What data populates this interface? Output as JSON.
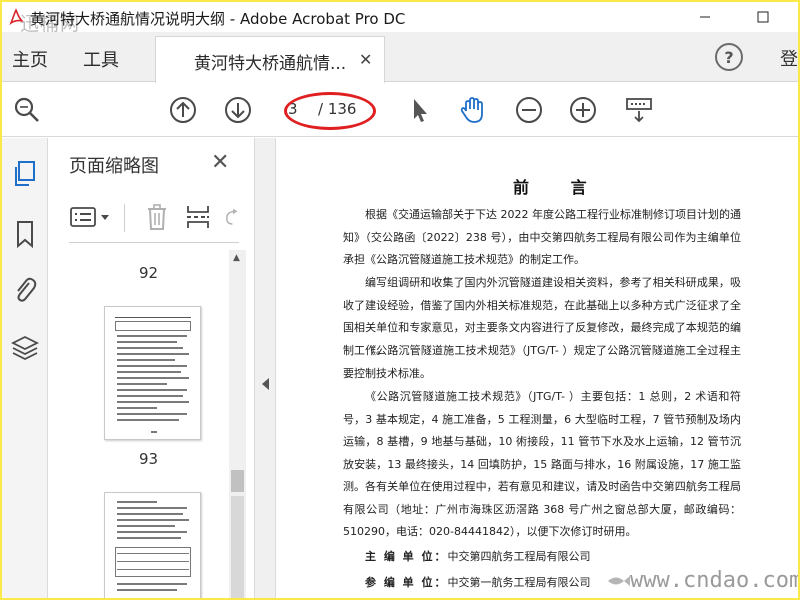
{
  "window": {
    "title": "黄河特大桥通航情况说明大纲 - Adobe Acrobat Pro DC",
    "watermark_top_left": "迅桶网"
  },
  "tabs": {
    "home": "主页",
    "tools": "工具",
    "document": "黄河特大桥通航情...",
    "login": "登"
  },
  "toolbar": {
    "current_page": "3",
    "total_pages": "/ 136"
  },
  "thumbnail_panel": {
    "title": "页面缩略图",
    "page_labels": [
      "92",
      "93"
    ]
  },
  "document": {
    "heading": "前 言",
    "paragraphs": [
      "根据《交通运输部关于下达 2022 年度公路工程行业标准制修订项目计划的通知》（交公路函〔2022〕238 号），由中交第四航务工程局有限公司作为主编单位承担《公路沉管隧道施工技术规范》的制定工作。",
      "编写组调研和收集了国内外沉管隧道建设相关资料，参考了相关科研成果，吸收了建设经验，借鉴了国内外相关标准规范，在此基础上以多种方式广泛征求了全国相关单位和专家意见，对主要条文内容进行了反复修改，最终完成了本规范的编制工作。",
      "《公路沉管隧道施工技术规范》（JTG/T- ）规定了公路沉管隧道施工全过程主要控制技术标准。",
      "《公路沉管隧道施工技术规范》（JTG/T- ）主要包括：1 总则，2 术语和符号，3 基本规定，4 施工准备，5 工程测量，6 大型临时工程，7 管节预制及场内运输，8 基槽，9 地基与基础，10 術接段，11 管节下水及水上运输，12 管节沉放安装，13 最终接头，14 回填防护，15 路面与排水，16 附属设施，17 施工监测。",
      "各有关单位在使用过程中，若有意见和建议，请及时函告中交第四航务工程局有限公司（地址：广州市海珠区沥滘路 368 号广州之窗总部大厦，邮政编码：510290，电话：020-84441842），以便下次修订时研用。"
    ],
    "editors": [
      {
        "label": "主 编 单 位：",
        "value": "中交第四航务工程局有限公司"
      },
      {
        "label": "参 编 单 位：",
        "value": "中交第一航务工程局有限公司"
      }
    ]
  },
  "watermark_bottom_right": "www.cndao.com"
}
